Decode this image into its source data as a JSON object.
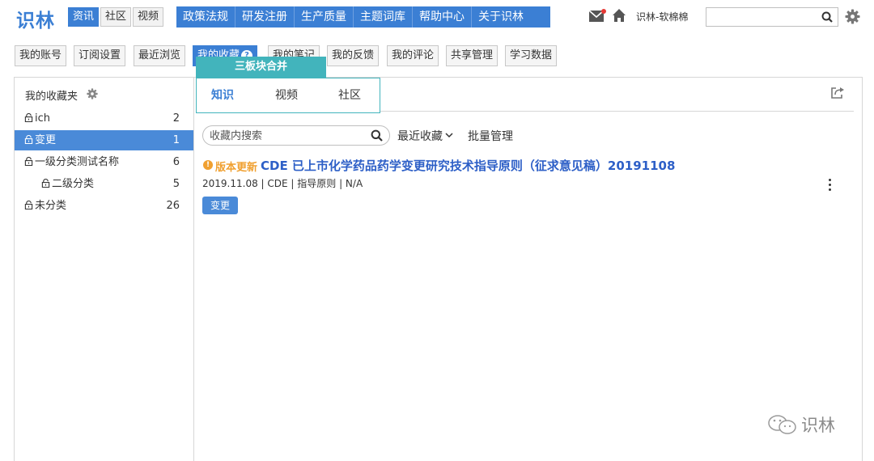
{
  "header": {
    "logo": "识林",
    "mode_tabs": [
      "资讯",
      "社区",
      "视频"
    ],
    "nav": [
      "政策法规",
      "研发注册",
      "生产质量",
      "主题词库",
      "帮助中心",
      "关于识林"
    ],
    "user_name": "识林-软棉棉",
    "search_value": ""
  },
  "subtabs": [
    "我的账号",
    "订阅设置",
    "最近浏览",
    "我的收藏",
    "我的笔记",
    "我的反馈",
    "我的评论",
    "共享管理",
    "学习数据"
  ],
  "overlay": {
    "banner": "三板块合并",
    "tabs": [
      "知识",
      "视频",
      "社区"
    ]
  },
  "sidebar": {
    "title": "我的收藏夹",
    "folders": [
      {
        "label": "ich",
        "count": "2"
      },
      {
        "label": "变更",
        "count": "1"
      },
      {
        "label": "一级分类测试名称",
        "count": "6"
      },
      {
        "label": "二级分类",
        "count": "5"
      },
      {
        "label": "未分类",
        "count": "26"
      }
    ]
  },
  "toolbar": {
    "search_placeholder": "收藏内搜索",
    "sort_label": "最近收藏",
    "batch_label": "批量管理"
  },
  "item": {
    "tag": "版本更新",
    "title": "CDE 已上市化学药品药学变更研究技术指导原则（征求意见稿）20191108",
    "meta": "2019.11.08 | CDE | 指导原则 | N/A",
    "badge": "变更"
  },
  "watermark": "识林",
  "colors": {
    "primary": "#3b7fd4",
    "teal": "#42b4bc",
    "orange": "#f0a030",
    "title_blue": "#2d5fc7"
  }
}
